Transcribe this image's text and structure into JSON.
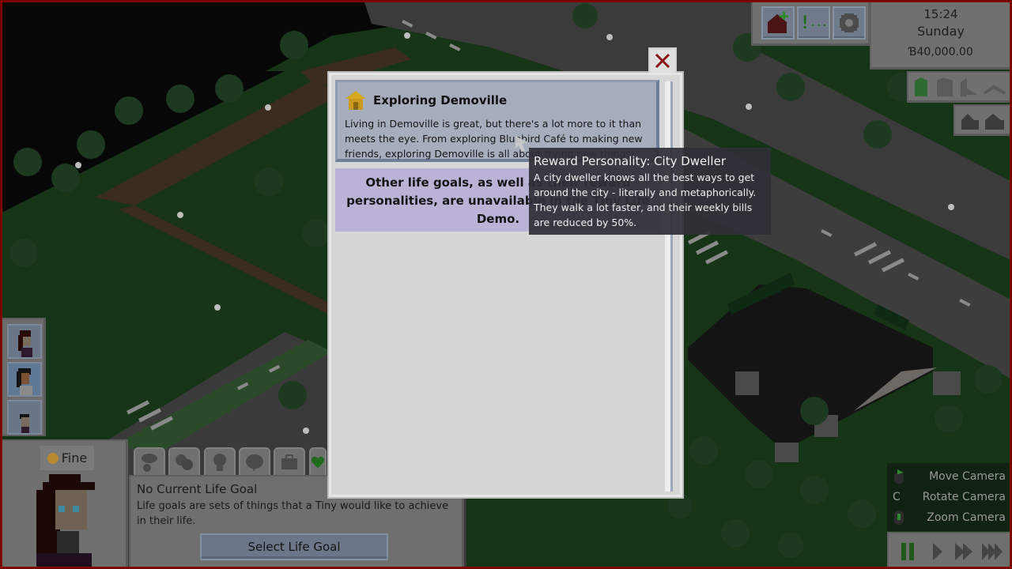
{
  "hud": {
    "toolbar": [
      {
        "name": "build-mode-button",
        "icon": "house-plus-icon"
      },
      {
        "name": "notifications-button",
        "icon": "exclamation-icon"
      },
      {
        "name": "settings-button",
        "icon": "gear-icon"
      }
    ],
    "clock": {
      "time": "15:24",
      "day": "Sunday",
      "money": "Ɓ40,000.00"
    },
    "build_tools": [
      "wall-full-icon",
      "wall-cutaway-icon",
      "wall-partial-icon",
      "wall-down-icon"
    ],
    "roof_tools": [
      "roof-up-icon",
      "roof-up-alt-icon"
    ],
    "camera_hints": [
      {
        "key": "mouse-drag-icon",
        "label": "Move Camera"
      },
      {
        "key": "C",
        "label": "Rotate Camera"
      },
      {
        "key": "mouse-wheel-icon",
        "label": "Zoom Camera"
      }
    ],
    "speed_controls": [
      "pause",
      "play",
      "fast",
      "faster"
    ],
    "active_speed": "pause"
  },
  "household": {
    "portraits": [
      "tiny-1",
      "tiny-2",
      "tiny-3"
    ],
    "selected_index": 1
  },
  "character": {
    "mood_label": "Fine",
    "tabs": [
      "needs-tab",
      "emotions-tab",
      "skills-tab",
      "relationships-tab",
      "job-tab",
      "life-goal-tab"
    ],
    "life_goal_title": "No Current Life Goal",
    "life_goal_desc": "Life goals are sets of things that a Tiny would like to achieve in their life.",
    "select_goal_label": "Select Life Goal"
  },
  "dialog": {
    "close_label": "×",
    "goal": {
      "title": "Exploring Demoville",
      "description": "Living in Demoville is great, but there's a lot more to it than meets the eye. From exploring Bluebird Café to making new friends, exploring Demoville is all about trying new things!"
    },
    "unavailable_notice": "Other life goals, as well as their reward personalities, are unavailable in the Tiny Life Demo."
  },
  "tooltip": {
    "title": "Reward Personality: City Dweller",
    "body": "A city dweller knows all the best ways to get around the city - literally and metaphorically. They walk a lot faster, and their weekly bills are reduced by 50%."
  },
  "colors": {
    "accent_green": "#2e6b2e",
    "close_red": "#8a1414",
    "goal_card": "#a6adbd",
    "notice_purple": "#bbb3d6",
    "frame_red": "#7a0000"
  }
}
